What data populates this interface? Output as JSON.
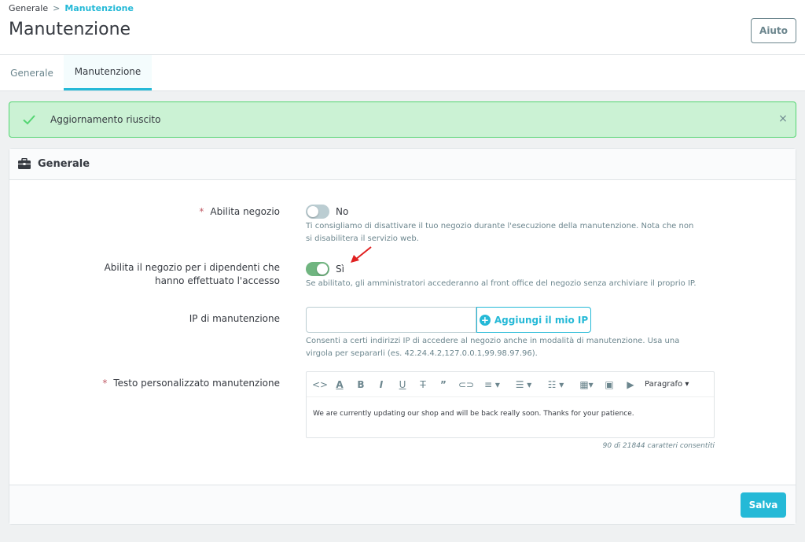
{
  "header": {
    "breadcrumb": {
      "parent": "Generale",
      "separator": ">",
      "current": "Manutenzione"
    },
    "title": "Manutenzione",
    "help_label": "Aiuto"
  },
  "tabs": [
    {
      "label": "Generale",
      "active": false
    },
    {
      "label": "Manutenzione",
      "active": true
    }
  ],
  "alert": {
    "message": "Aggiornamento riuscito",
    "close_glyph": "×",
    "icon": "check-icon"
  },
  "panel": {
    "title": "Generale",
    "icon": "toolbox-icon",
    "fields": {
      "enable_shop": {
        "required_mark": "*",
        "label": "Abilita negozio",
        "state_label": "No",
        "enabled": false,
        "help": "Ti consigliamo di disattivare il tuo negozio durante l'esecuzione della manutenzione. Nota che non si disabilitera il servizio web."
      },
      "enable_logged_in": {
        "label": "Abilita il negozio per i dipendenti che hanno effettuato l'accesso",
        "state_label": "Sì",
        "enabled": true,
        "help": "Se abilitato, gli amministratori accederanno al front office del negozio senza archiviare il proprio IP."
      },
      "maintenance_ip": {
        "label": "IP di manutenzione",
        "value": "",
        "add_button": "Aggiungi il mio IP",
        "help": "Consenti a certi indirizzi IP di accedere al negozio anche in modalità di manutenzione. Usa una virgola per separarli (es. 42.24.4.2,127.0.0.1,99.98.97.96)."
      },
      "maintenance_text": {
        "required_mark": "*",
        "label": "Testo personalizzato manutenzione",
        "content": "We are currently updating our shop and will be back really soon. Thanks for your patience.",
        "counter": "90 di 21844 caratteri consentiti",
        "format_dropdown": "Paragrafo",
        "toolbar": [
          "code-icon",
          "text-color-icon",
          "bold-icon",
          "italic-icon",
          "underline-icon",
          "strikethrough-icon",
          "quote-icon",
          "link-icon",
          "align-icon",
          "bullet-list-icon",
          "numbered-list-icon",
          "table-icon",
          "image-icon",
          "video-icon"
        ]
      }
    },
    "save_label": "Salva"
  },
  "colors": {
    "accent": "#25b9d7",
    "success_bg": "#cbf2d4",
    "success_border": "#53d572",
    "switch_on": "#70b580",
    "switch_off": "#bbcdd2",
    "required": "#c05c67",
    "annotation_arrow": "#e02020"
  }
}
